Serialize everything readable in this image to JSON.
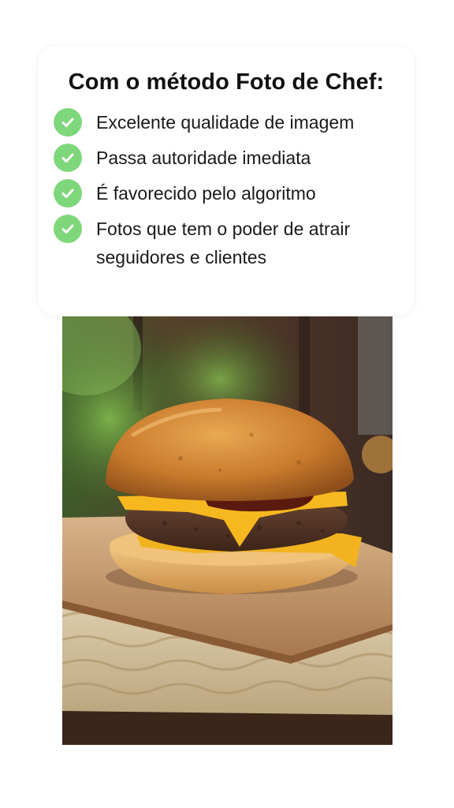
{
  "headline": {
    "prefix": "Com o método ",
    "bold": "Foto de Chef:"
  },
  "benefits": [
    {
      "icon": "check-circle-icon",
      "text": "Excelente qualidade de imagem"
    },
    {
      "icon": "check-circle-icon",
      "text": "Passa autoridade imediata"
    },
    {
      "icon": "check-circle-icon",
      "text": "É favorecido pelo algoritmo"
    },
    {
      "icon": "check-circle-icon",
      "text": "Fotos que tem o poder de atrair seguidores e clientes"
    }
  ],
  "colors": {
    "check_green": "#7ed77a",
    "text": "#1a1a1a",
    "background": "#ffffff"
  },
  "photo": {
    "subject": "cheeseburger-on-wooden-board"
  }
}
